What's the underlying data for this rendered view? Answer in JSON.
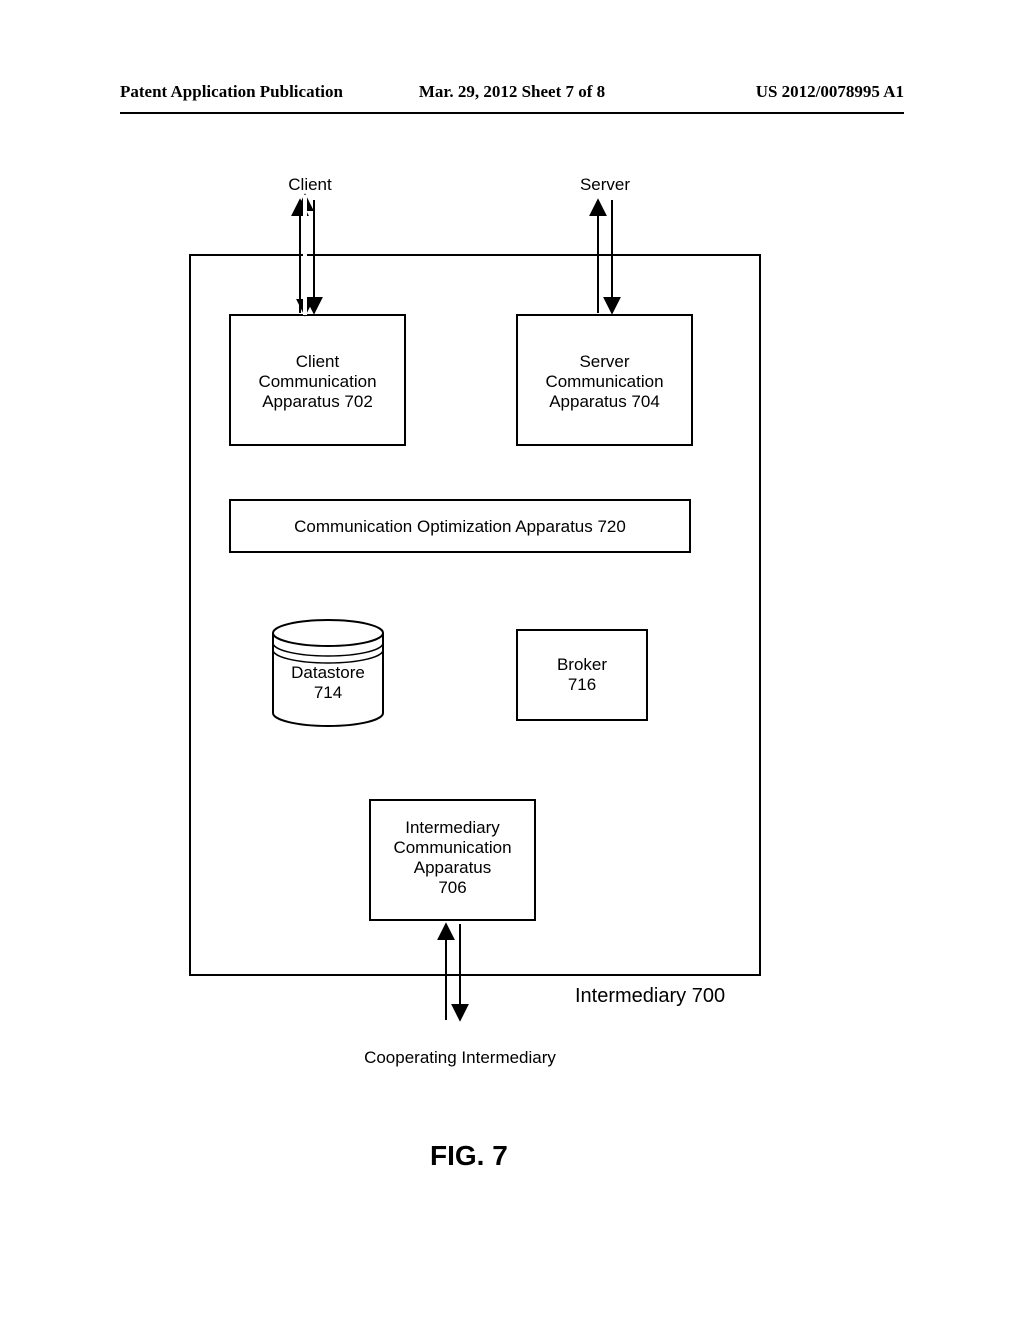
{
  "header": {
    "left": "Patent Application Publication",
    "center": "Mar. 29, 2012  Sheet 7 of 8",
    "right": "US 2012/0078995 A1"
  },
  "labels": {
    "client": "Client",
    "server": "Server",
    "clientComm1": "Client",
    "clientComm2": "Communication",
    "clientComm3": "Apparatus 702",
    "serverComm1": "Server",
    "serverComm2": "Communication",
    "serverComm3": "Apparatus 704",
    "commOpt": "Communication Optimization Apparatus 720",
    "datastore1": "Datastore",
    "datastore2": "714",
    "broker1": "Broker",
    "broker2": "716",
    "interComm1": "Intermediary",
    "interComm2": "Communication",
    "interComm3": "Apparatus",
    "interComm4": "706",
    "intermediary700": "Intermediary 700",
    "cooperating": "Cooperating Intermediary",
    "figure": "FIG. 7"
  }
}
